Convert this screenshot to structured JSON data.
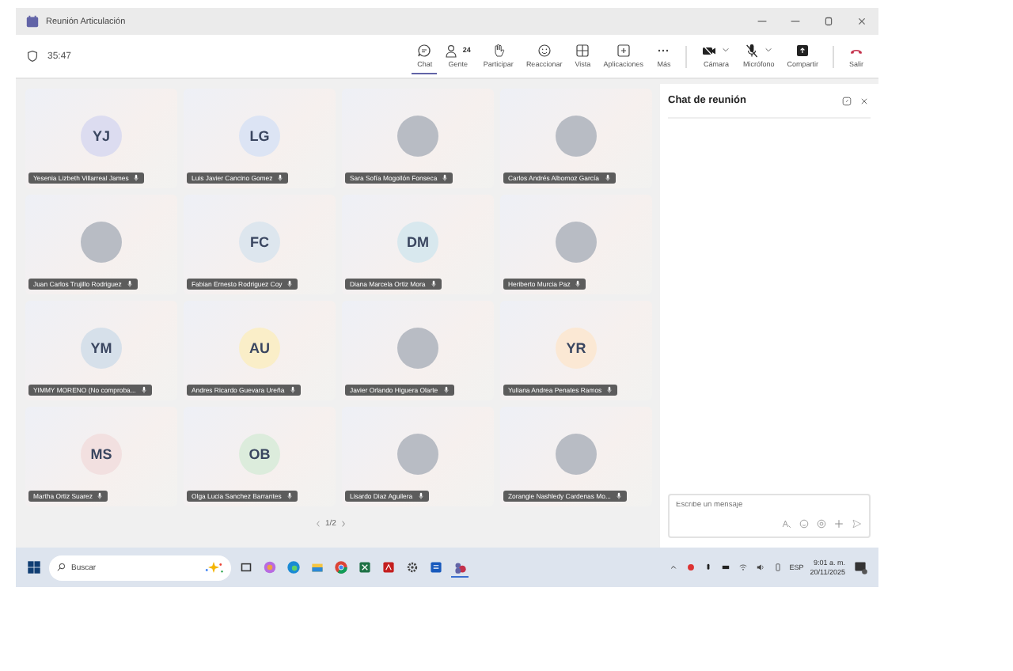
{
  "window": {
    "title": "Reunión Articulación"
  },
  "timer": "35:47",
  "toolbar": [
    {
      "kind": "chat",
      "label": "Chat",
      "selected": true
    },
    {
      "kind": "people",
      "label": "Gente",
      "badge": "24",
      "selected": false
    },
    {
      "kind": "hand",
      "label": "Participar",
      "selected": false
    },
    {
      "kind": "react",
      "label": "Reaccionar",
      "selected": false
    },
    {
      "kind": "view",
      "label": "Vista",
      "selected": false
    },
    {
      "kind": "apps",
      "label": "Aplicaciones",
      "selected": false
    },
    {
      "kind": "more",
      "label": "Más",
      "selected": false
    },
    {
      "kind": "camera",
      "label": "Cámara",
      "selected": false
    },
    {
      "kind": "mic",
      "label": "Micrófono",
      "selected": false
    },
    {
      "kind": "share",
      "label": "Compartir",
      "selected": false
    },
    {
      "kind": "leave",
      "label": "Salir",
      "selected": false
    }
  ],
  "participants": [
    {
      "kind": "initials",
      "initials": "YJ",
      "color": "#dcdcf0",
      "name": "Yesenia Lizbeth Villarreal James"
    },
    {
      "kind": "initials",
      "initials": "LG",
      "color": "#dce4f4",
      "name": "Luis Javier Cancino Gomez"
    },
    {
      "kind": "photo",
      "name": "Sara Sofía Mogollón Fonseca"
    },
    {
      "kind": "photo",
      "name": "Carlos Andrés Albornoz García"
    },
    {
      "kind": "photo",
      "name": "Juan Carlos Trujillo Rodriguez"
    },
    {
      "kind": "initials",
      "initials": "FC",
      "color": "#dde6ee",
      "name": "Fabian Ernesto Rodriguez Coy"
    },
    {
      "kind": "initials",
      "initials": "DM",
      "color": "#d8e8ee",
      "name": "Diana Marcela Ortiz Mora"
    },
    {
      "kind": "photo",
      "name": "Heriberto Murcia Paz"
    },
    {
      "kind": "initials",
      "initials": "YM",
      "color": "#d6e0ea",
      "name": "YIMMY MORENO (No comproba..."
    },
    {
      "kind": "initials",
      "initials": "AU",
      "color": "#faeec8",
      "name": "Andres Ricardo Guevara Ureña"
    },
    {
      "kind": "photo",
      "name": "Javier Orlando Higuera Olarte"
    },
    {
      "kind": "initials",
      "initials": "YR",
      "color": "#fbe8d4",
      "name": "Yuliana Andrea Penates Ramos"
    },
    {
      "kind": "initials",
      "initials": "MS",
      "color": "#f2e0e0",
      "name": "Martha Ortiz Suarez"
    },
    {
      "kind": "initials",
      "initials": "OB",
      "color": "#dcecdc",
      "name": "Olga Lucia Sanchez Barrantes"
    },
    {
      "kind": "photo",
      "name": "Lisardo Diaz Aguilera"
    },
    {
      "kind": "photo",
      "name": "Zorangie Nashledy Cardenas Mo..."
    }
  ],
  "pager": "1/2",
  "chat": {
    "title": "Chat de reunión",
    "placeholder": "Escribe un mensaje"
  },
  "taskbar": {
    "search_placeholder": "Buscar",
    "language": "ESP",
    "time": "9:01 a. m.",
    "date": "20/11/2025"
  }
}
